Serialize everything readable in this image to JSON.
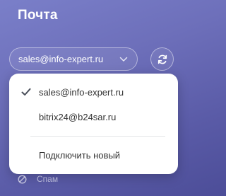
{
  "panel": {
    "title": "Почта"
  },
  "account_select": {
    "value": "sales@info-expert.ru",
    "chevron_icon": "chevron-down-icon"
  },
  "refresh": {
    "icon": "refresh-icon"
  },
  "dropdown": {
    "items": [
      {
        "label": "sales@info-expert.ru",
        "selected": true,
        "icon": "check-icon"
      },
      {
        "label": "bitrix24@b24sar.ru",
        "selected": false
      }
    ],
    "connect_new_label": "Подключить новый"
  },
  "folders": [
    {
      "label": "Спам",
      "icon": "ban-icon"
    }
  ],
  "colors": {
    "background_top": "#7a7fc9",
    "background_bottom": "#4c4d98",
    "dropdown_bg": "#ffffff",
    "text_dark": "#333333",
    "text_light": "#ffffff"
  }
}
